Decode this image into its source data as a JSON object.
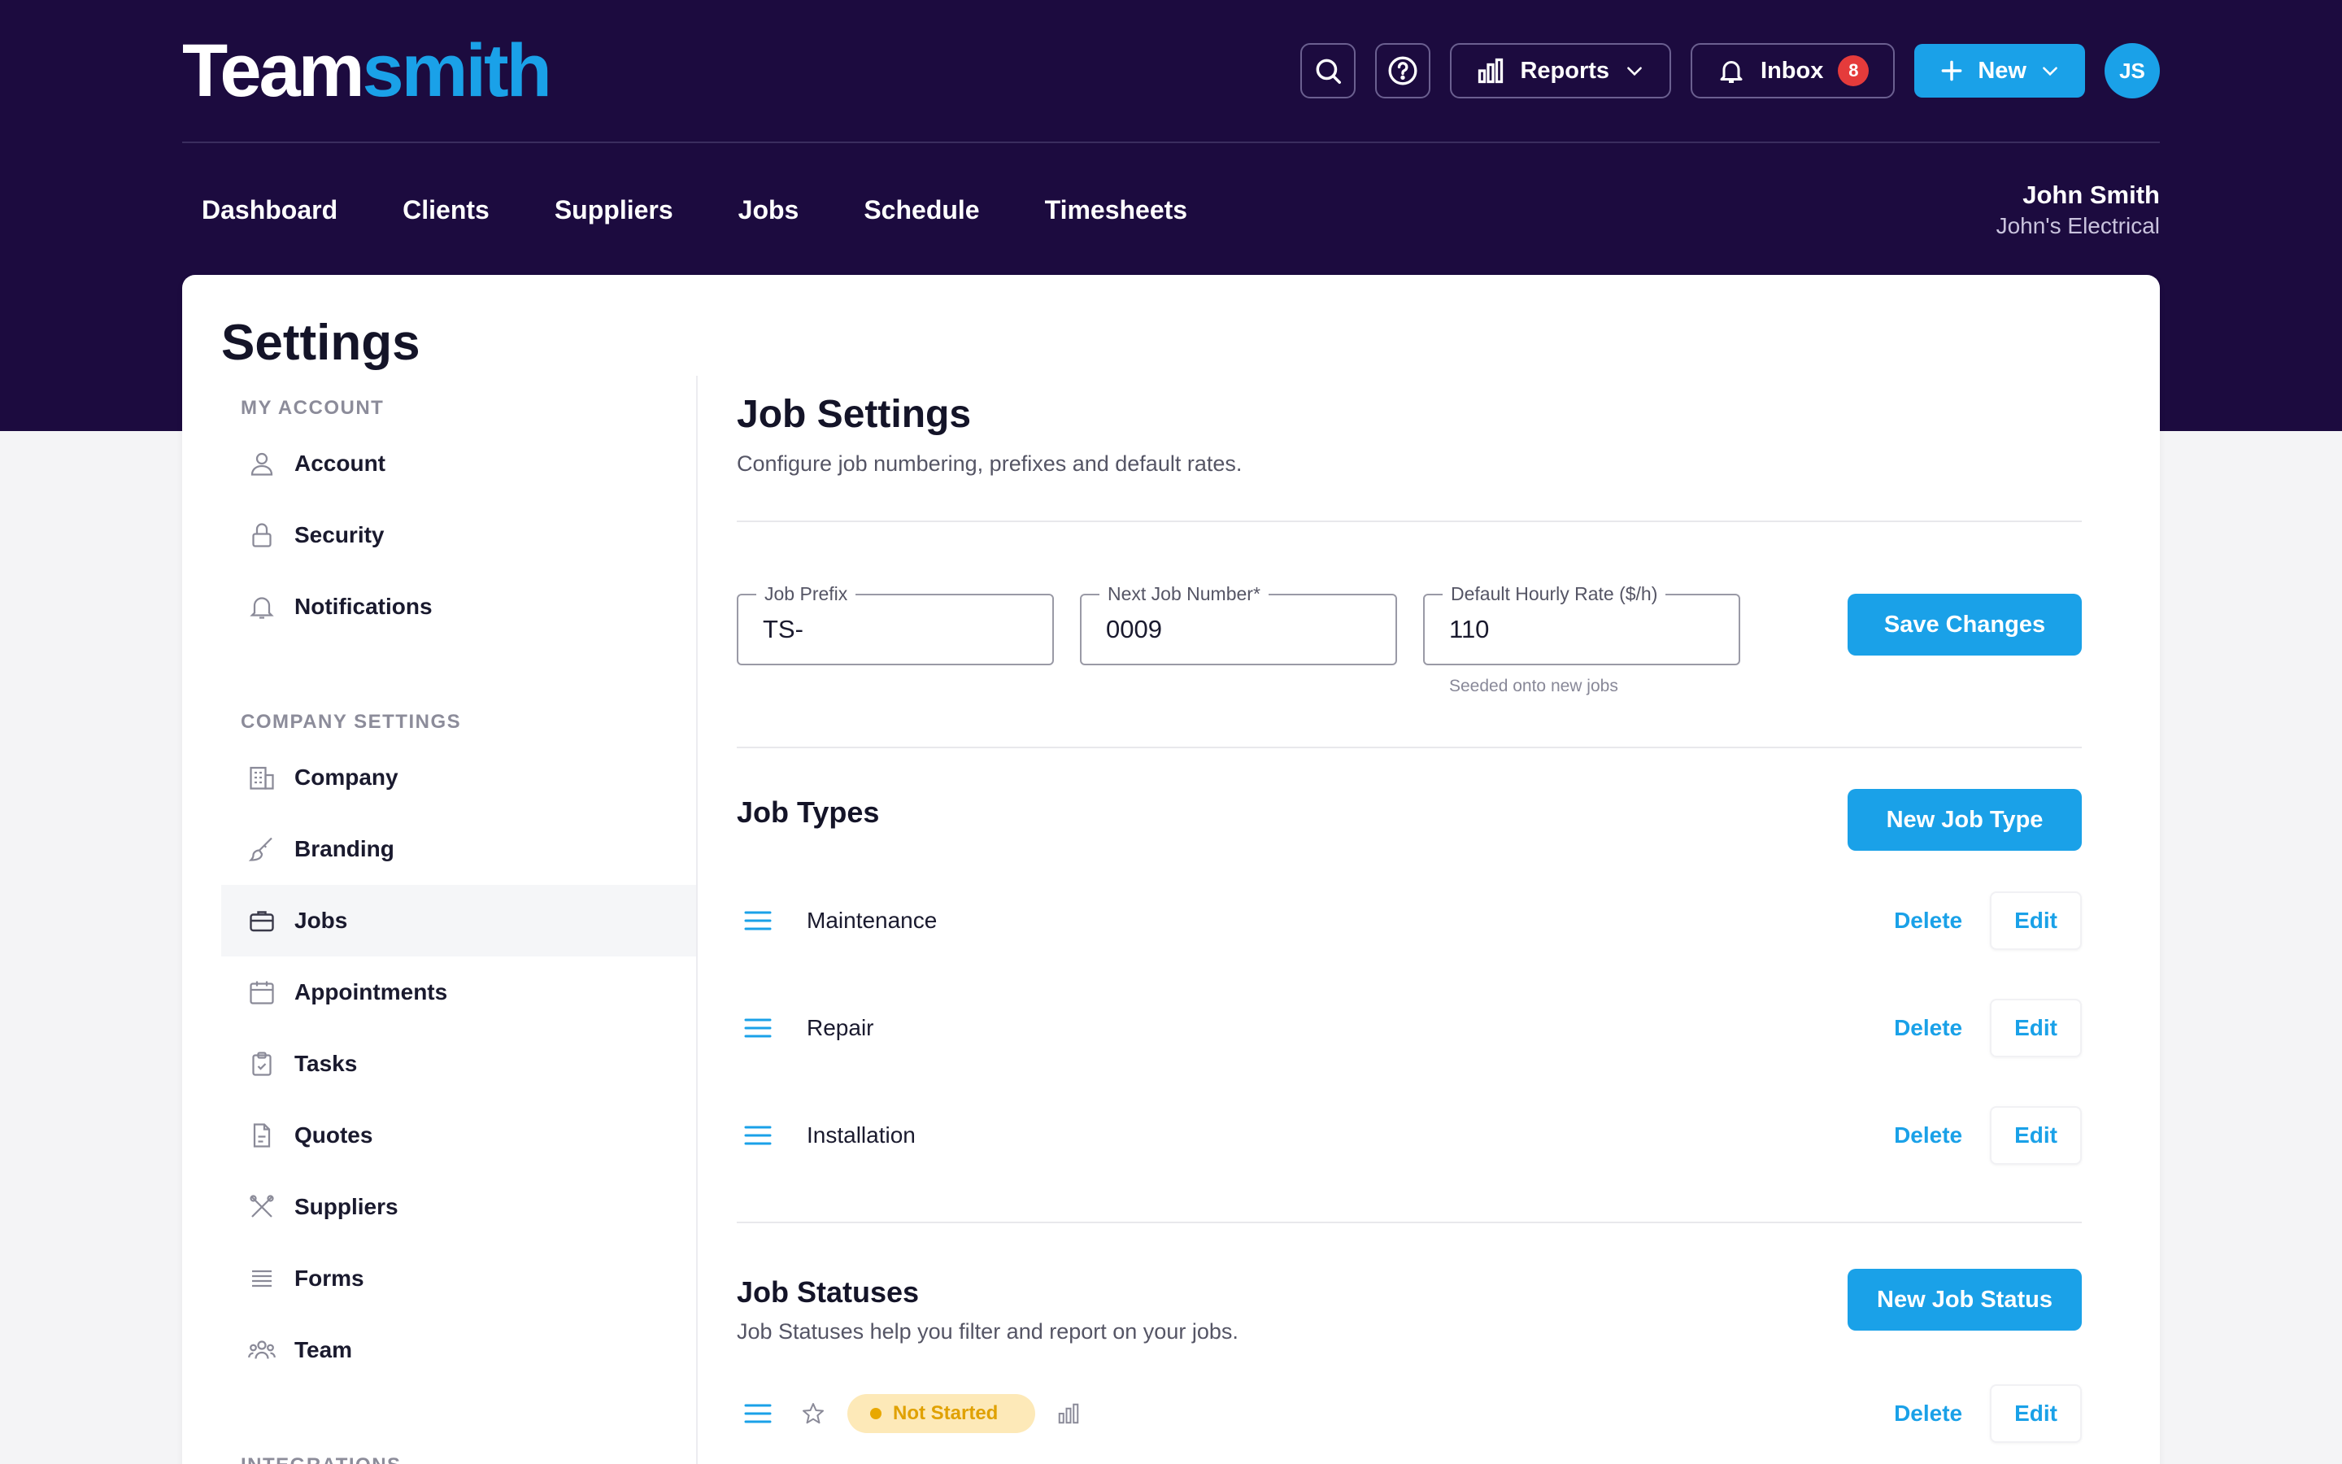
{
  "app": {
    "logo_part1": "Team",
    "logo_part2": "smith",
    "colors": {
      "brand_dark": "#1c0b3f",
      "accent": "#1aa1e8",
      "badge": "#e53b3b",
      "status_pending": "#e8a800"
    }
  },
  "header": {
    "reports_label": "Reports",
    "inbox_label": "Inbox",
    "inbox_count": "8",
    "new_label": "New",
    "avatar_initials": "JS"
  },
  "nav": {
    "items": [
      "Dashboard",
      "Clients",
      "Suppliers",
      "Jobs",
      "Schedule",
      "Timesheets"
    ],
    "user_name": "John Smith",
    "company_name": "John's Electrical"
  },
  "page": {
    "title": "Settings"
  },
  "sidebar": {
    "sections": [
      {
        "heading": "MY ACCOUNT",
        "items": [
          {
            "label": "Account",
            "icon": "user-icon"
          },
          {
            "label": "Security",
            "icon": "lock-icon"
          },
          {
            "label": "Notifications",
            "icon": "bell-icon"
          }
        ]
      },
      {
        "heading": "COMPANY SETTINGS",
        "items": [
          {
            "label": "Company",
            "icon": "building-icon"
          },
          {
            "label": "Branding",
            "icon": "brush-icon"
          },
          {
            "label": "Jobs",
            "icon": "briefcase-icon",
            "active": true
          },
          {
            "label": "Appointments",
            "icon": "calendar-icon"
          },
          {
            "label": "Tasks",
            "icon": "clipboard-check-icon"
          },
          {
            "label": "Quotes",
            "icon": "document-icon"
          },
          {
            "label": "Suppliers",
            "icon": "tools-icon"
          },
          {
            "label": "Forms",
            "icon": "list-lines-icon"
          },
          {
            "label": "Team",
            "icon": "team-icon"
          }
        ]
      },
      {
        "heading": "INTEGRATIONS",
        "items": []
      }
    ]
  },
  "job_settings": {
    "title": "Job Settings",
    "subtitle": "Configure job numbering, prefixes and default rates.",
    "fields": {
      "prefix": {
        "label": "Job Prefix",
        "value": "TS-"
      },
      "next_number": {
        "label": "Next Job Number*",
        "value": "0009"
      },
      "hourly_rate": {
        "label": "Default Hourly Rate ($/h)",
        "value": "110",
        "helper": "Seeded onto new jobs"
      }
    },
    "save_label": "Save Changes"
  },
  "job_types": {
    "title": "Job Types",
    "new_label": "New Job Type",
    "items": [
      "Maintenance",
      "Repair",
      "Installation"
    ],
    "delete_label": "Delete",
    "edit_label": "Edit"
  },
  "job_statuses": {
    "title": "Job Statuses",
    "subtitle": "Job Statuses help you filter and report on your jobs.",
    "new_label": "New Job Status",
    "items": [
      {
        "label": "Not Started"
      }
    ],
    "delete_label": "Delete",
    "edit_label": "Edit"
  }
}
